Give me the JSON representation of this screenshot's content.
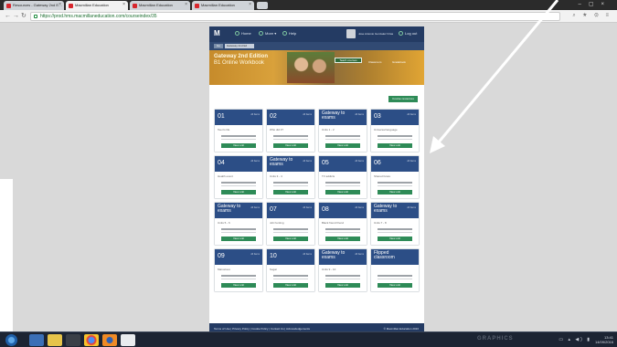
{
  "browser": {
    "tabs": [
      {
        "label": "Resources - Gateway 2nd E…"
      },
      {
        "label": "Macmillan Education"
      },
      {
        "label": "Macmillan Education"
      },
      {
        "label": "Macmillan Education"
      }
    ],
    "url": "https://prod.hms.macmillaneducation.com/courseindex/35"
  },
  "site": {
    "logo": "M",
    "menu": {
      "home": "Home",
      "more": "More ▾",
      "help": "Help"
    },
    "user_name": "Jose Antonio Gonzalez Frias",
    "logout": "Log out",
    "breadcrumb": {
      "home": "Go",
      "course": "Gateway 2nd Ed"
    }
  },
  "hero": {
    "title": "Gateway 2nd Edition",
    "subtitle": "B1 Online Workbook",
    "button": "Teach courses",
    "link1": "Classroom",
    "link2": "Gradebook"
  },
  "actions": {
    "manage": "Course resources"
  },
  "cards": [
    {
      "num": "01",
      "title": "Teen's life",
      "meta": "All Items"
    },
    {
      "num": "02",
      "title": "Who did it?",
      "meta": "All Items"
    },
    {
      "num": "Gateway to",
      "num2": "exams",
      "title": "Units 1 - 2",
      "meta": "All Items"
    },
    {
      "num": "03",
      "title": "Universal language",
      "meta": "All Items"
    },
    {
      "num": "04",
      "title": "Health event",
      "meta": "All Items"
    },
    {
      "num": "Gateway to",
      "num2": "exams",
      "title": "Units 3 - 4",
      "meta": "All Items"
    },
    {
      "num": "05",
      "title": "TV addicts",
      "meta": "All Items"
    },
    {
      "num": "06",
      "title": "Shared future",
      "meta": "All Items"
    },
    {
      "num": "Gateway to",
      "num2": "exams",
      "title": "Units 5 - 6",
      "meta": "All Items"
    },
    {
      "num": "07",
      "title": "Job hunting",
      "meta": "All Items"
    },
    {
      "num": "08",
      "title": "Black friend friend",
      "meta": "All Items"
    },
    {
      "num": "Gateway to",
      "num2": "exams",
      "title": "Units 7 - 8",
      "meta": "All Items"
    },
    {
      "num": "09",
      "title": "Marvelous",
      "meta": "All Items"
    },
    {
      "num": "10",
      "title": "Sugar",
      "meta": "All Items"
    },
    {
      "num": "Gateway to",
      "num2": "exams",
      "title": "Units 9 - 10",
      "meta": "All Items"
    },
    {
      "num": "Flipped",
      "num2": "classroom",
      "title": "",
      "meta": ""
    }
  ],
  "card_button": "View unit",
  "footer": {
    "links": "Terms of Use  |  Privacy Policy  |  Cookie Policy  |  Contact Us  |  Acknowledgements",
    "copyright": "© Macmillan Education 2016"
  },
  "taskbar": {
    "time": "13:41",
    "date": "14/09/2016",
    "watermark": "GRAPHICS"
  }
}
